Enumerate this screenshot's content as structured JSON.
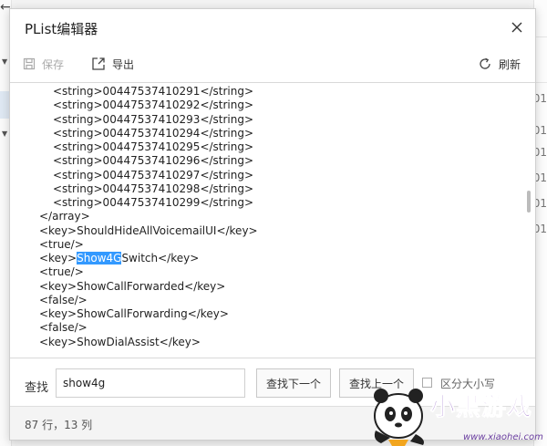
{
  "dialog": {
    "title": "PList编辑器",
    "toolbar": {
      "save_label": "保存",
      "export_label": "导出",
      "refresh_label": "刷新"
    }
  },
  "editor": {
    "lines": [
      {
        "indent": 1,
        "text": "<string>00447537410291</string>"
      },
      {
        "indent": 1,
        "text": "<string>00447537410292</string>"
      },
      {
        "indent": 1,
        "text": "<string>00447537410293</string>"
      },
      {
        "indent": 1,
        "text": "<string>00447537410294</string>"
      },
      {
        "indent": 1,
        "text": "<string>00447537410295</string>"
      },
      {
        "indent": 1,
        "text": "<string>00447537410296</string>"
      },
      {
        "indent": 1,
        "text": "<string>00447537410297</string>"
      },
      {
        "indent": 1,
        "text": "<string>00447537410298</string>"
      },
      {
        "indent": 1,
        "text": "<string>00447537410299</string>"
      },
      {
        "indent": 0,
        "text": "</array>"
      },
      {
        "indent": 0,
        "text": "<key>ShouldHideAllVoicemailUI</key>"
      },
      {
        "indent": 0,
        "text": "<true/>"
      },
      {
        "indent": 0,
        "text": "<key>Show4GSwitch</key>",
        "highlight": "Show4G"
      },
      {
        "indent": 0,
        "text": "<true/>"
      },
      {
        "indent": 0,
        "text": "<key>ShowCallForwarded</key>"
      },
      {
        "indent": 0,
        "text": "<false/>"
      },
      {
        "indent": 0,
        "text": "<key>ShowCallForwarding</key>"
      },
      {
        "indent": 0,
        "text": "<false/>"
      },
      {
        "indent": 0,
        "text": "<key>ShowDialAssist</key>"
      }
    ]
  },
  "search": {
    "label": "查找",
    "value": "show4g",
    "find_next_label": "查找下一个",
    "find_prev_label": "查找上一个",
    "case_sensitive_label": "区分大小写",
    "case_sensitive_checked": false
  },
  "status": {
    "text": "87 行，13 列"
  },
  "background": {
    "right_numbers": [
      "01",
      "01",
      "01",
      "01",
      "01",
      "01"
    ]
  },
  "watermark": {
    "text": "小黑游戏",
    "url": "www.xiaohei.com"
  },
  "colors": {
    "highlight": "#3399ff",
    "accent_purple": "#7a3fb6"
  }
}
